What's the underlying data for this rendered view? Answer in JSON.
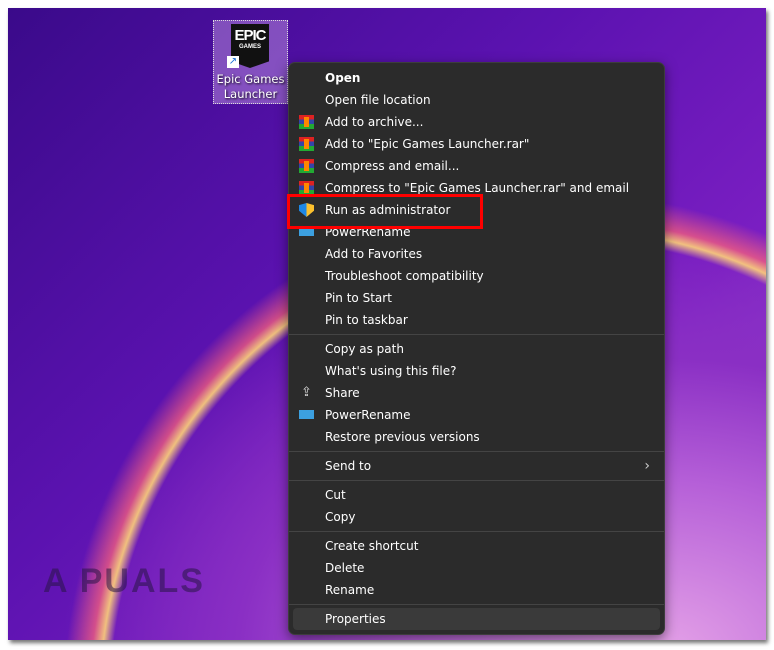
{
  "desktop_icon": {
    "logo_top": "EPIC",
    "logo_bottom": "GAMES",
    "label_line1": "Epic Games",
    "label_line2": "Launcher"
  },
  "watermark": "A  PUALS",
  "menu": [
    {
      "label": "Open",
      "bold": true
    },
    {
      "label": "Open file location"
    },
    {
      "label": "Add to archive...",
      "icon": "winrar"
    },
    {
      "label": "Add to \"Epic Games Launcher.rar\"",
      "icon": "winrar"
    },
    {
      "label": "Compress and email...",
      "icon": "winrar"
    },
    {
      "label": "Compress to \"Epic Games Launcher.rar\" and email",
      "icon": "winrar"
    },
    {
      "label": "Run as administrator",
      "icon": "shield"
    },
    {
      "label": "PowerRename",
      "icon": "powerrename"
    },
    {
      "label": "Add to Favorites"
    },
    {
      "label": "Troubleshoot compatibility"
    },
    {
      "label": "Pin to Start"
    },
    {
      "label": "Pin to taskbar"
    },
    {
      "sep": true
    },
    {
      "label": "Copy as path"
    },
    {
      "label": "What's using this file?"
    },
    {
      "label": "Share",
      "icon": "share"
    },
    {
      "label": "PowerRename",
      "icon": "powerrename"
    },
    {
      "label": "Restore previous versions"
    },
    {
      "sep": true
    },
    {
      "label": "Send to",
      "submenu": true
    },
    {
      "sep": true
    },
    {
      "label": "Cut"
    },
    {
      "label": "Copy"
    },
    {
      "sep": true
    },
    {
      "label": "Create shortcut"
    },
    {
      "label": "Delete"
    },
    {
      "label": "Rename"
    },
    {
      "sep": true
    },
    {
      "label": "Properties",
      "highlighted": true
    }
  ]
}
